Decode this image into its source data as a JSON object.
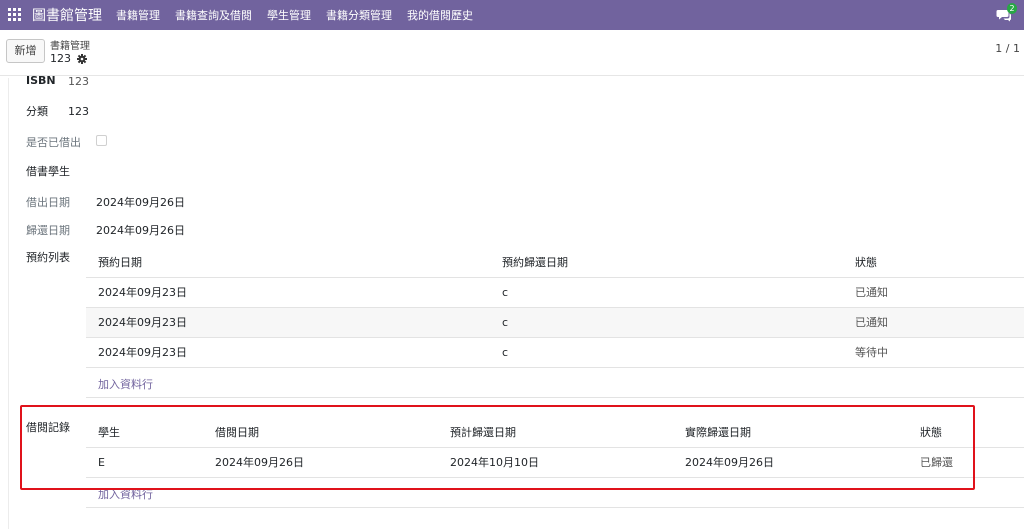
{
  "navbar": {
    "brand": "圖書館管理",
    "menu": [
      "書籍管理",
      "書籍查詢及借閱",
      "學生管理",
      "書籍分類管理",
      "我的借閱歷史"
    ],
    "chat_count": "2",
    "color": "#71639e"
  },
  "control": {
    "new_label": "新增",
    "breadcrumb_parent": "書籍管理",
    "breadcrumb_current": "123",
    "pager": "1 / 1"
  },
  "form": {
    "isbn_label": "ISBN",
    "isbn_value": "123",
    "category_label": "分類",
    "category_value": "123",
    "borrowed_label": "是否已借出",
    "borrower_label": "借書學生",
    "borrow_date_label": "借出日期",
    "borrow_date_value": "2024年09月26日",
    "return_date_label": "歸還日期",
    "return_date_value": "2024年09月26日"
  },
  "reservations": {
    "label": "預約列表",
    "headers": [
      "預約日期",
      "預約歸還日期",
      "狀態"
    ],
    "rows": [
      [
        "2024年09月23日",
        "c",
        "已通知"
      ],
      [
        "2024年09月23日",
        "c",
        "已通知"
      ],
      [
        "2024年09月23日",
        "c",
        "等待中"
      ]
    ],
    "add_line": "加入資料行"
  },
  "history": {
    "label": "借閱記錄",
    "headers": [
      "學生",
      "借閱日期",
      "預計歸還日期",
      "實際歸還日期",
      "狀態"
    ],
    "rows": [
      [
        "E",
        "2024年09月26日",
        "2024年10月10日",
        "2024年09月26日",
        "已歸還"
      ]
    ],
    "add_line": "加入資料行"
  },
  "highlight_color": "#e0121b"
}
